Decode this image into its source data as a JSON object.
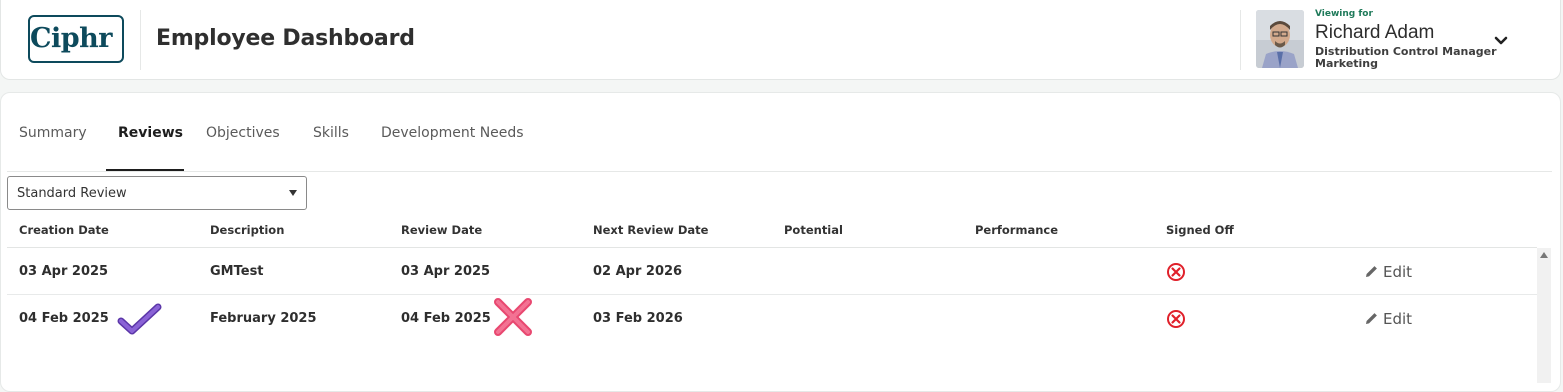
{
  "header": {
    "logo_text": "Ciphr",
    "title": "Employee Dashboard",
    "user": {
      "viewing_for_label": "Viewing for",
      "name": "Richard Adam",
      "role": "Distribution Control Manager",
      "department": "Marketing"
    }
  },
  "tabs": [
    {
      "label": "Summary",
      "active": false
    },
    {
      "label": "Reviews",
      "active": true
    },
    {
      "label": "Objectives",
      "active": false
    },
    {
      "label": "Skills",
      "active": false
    },
    {
      "label": "Development Needs",
      "active": false
    }
  ],
  "review_type_select": {
    "value": "Standard Review"
  },
  "table": {
    "columns": [
      "Creation Date",
      "Description",
      "Review Date",
      "Next Review Date",
      "Potential",
      "Performance",
      "Signed Off"
    ],
    "rows": [
      {
        "creation_date": "03 Apr 2025",
        "description": "GMTest",
        "review_date": "03 Apr 2025",
        "next_review_date": "02 Apr 2026",
        "potential": "",
        "performance": "",
        "signed_off": false,
        "edit_label": "Edit"
      },
      {
        "creation_date": "04 Feb 2025",
        "description": "February 2025",
        "review_date": "04 Feb 2025",
        "next_review_date": "03 Feb 2026",
        "potential": "",
        "performance": "",
        "signed_off": false,
        "edit_label": "Edit"
      }
    ]
  },
  "colors": {
    "brand": "#0d4a5c",
    "viewing_for": "#1f7a5a",
    "not_signed": "#e0202a",
    "check_annotation": "#7b55c9",
    "cross_annotation": "#ee5a7e"
  },
  "icons": {
    "signed_off_status": "x-circle-icon",
    "edit": "pencil-icon",
    "user_menu": "chevron-down-icon",
    "annotation_row2_creation": "check-mark-icon",
    "annotation_row2_review": "cross-mark-icon"
  }
}
